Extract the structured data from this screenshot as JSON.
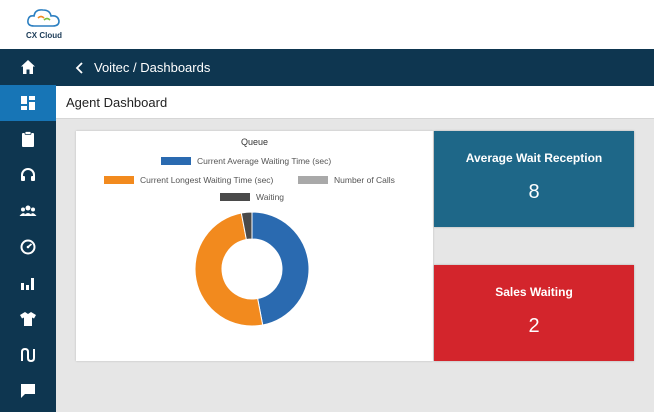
{
  "logo": {
    "text": "CX Cloud"
  },
  "topbar": {
    "breadcrumb": "Voitec / Dashboards",
    "back_icon": "chevron-left-icon"
  },
  "subheader": {
    "title": "Agent Dashboard"
  },
  "sidebar": {
    "items": [
      {
        "icon": "home-icon",
        "active": false
      },
      {
        "icon": "dashboard-icon",
        "active": true
      },
      {
        "icon": "clipboard-icon",
        "active": false
      },
      {
        "icon": "headset-icon",
        "active": false
      },
      {
        "icon": "users-icon",
        "active": false
      },
      {
        "icon": "gauge-icon",
        "active": false
      },
      {
        "icon": "bar-chart-icon",
        "active": false
      },
      {
        "icon": "shirt-icon",
        "active": false
      },
      {
        "icon": "route-icon",
        "active": false
      },
      {
        "icon": "chat-icon",
        "active": false
      }
    ]
  },
  "chart_data": {
    "type": "pie",
    "title": "Queue",
    "legend_position": "top",
    "series": [
      {
        "name": "Current Average Waiting Time (sec)",
        "value": 47,
        "color": "#2a6ab0"
      },
      {
        "name": "Current Longest Waiting Time (sec)",
        "value": 50,
        "color": "#f28a1e"
      },
      {
        "name": "Number of Calls",
        "value": 0,
        "color": "#a9a9a9"
      },
      {
        "name": "Waiting",
        "value": 3,
        "color": "#4a4a4a"
      }
    ]
  },
  "kpis": {
    "average_wait_reception": {
      "label": "Average Wait Reception",
      "value": "8",
      "color": "#1e6788"
    },
    "sales_waiting": {
      "label": "Sales Waiting",
      "value": "2",
      "color": "#d3252c"
    }
  }
}
